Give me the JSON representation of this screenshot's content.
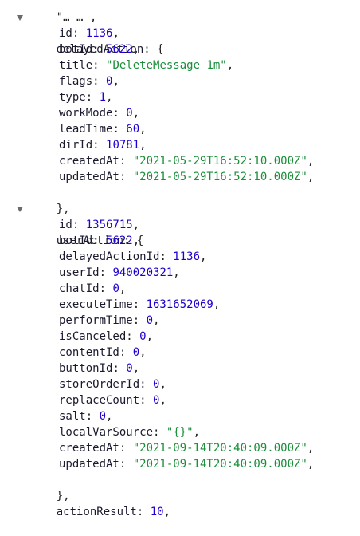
{
  "colors": {
    "key": "#1a1a2e",
    "number": "#1c00cf",
    "string": "#1a8f3a",
    "toggle": "#6b6b6b"
  },
  "top_cut": "\"… … ,",
  "delayedAction": {
    "key": "delayedAction",
    "open": ": {",
    "close": "},",
    "icon": "collapse-triangle-icon",
    "fields": [
      {
        "key": "id",
        "value": "1136",
        "kind": "num"
      },
      {
        "key": "botId",
        "value": "5622",
        "kind": "num"
      },
      {
        "key": "title",
        "value": "\"DeleteMessage 1m\"",
        "kind": "str"
      },
      {
        "key": "flags",
        "value": "0",
        "kind": "num"
      },
      {
        "key": "type",
        "value": "1",
        "kind": "num"
      },
      {
        "key": "workMode",
        "value": "0",
        "kind": "num"
      },
      {
        "key": "leadTime",
        "value": "60",
        "kind": "num"
      },
      {
        "key": "dirId",
        "value": "10781",
        "kind": "num"
      },
      {
        "key": "createdAt",
        "value": "\"2021-05-29T16:52:10.000Z\"",
        "kind": "str"
      },
      {
        "key": "updatedAt",
        "value": "\"2021-05-29T16:52:10.000Z\"",
        "kind": "str"
      }
    ]
  },
  "userAction": {
    "key": "userAction",
    "open": ": {",
    "close": "},",
    "icon": "collapse-triangle-icon",
    "fields": [
      {
        "key": "id",
        "value": "1356715",
        "kind": "num"
      },
      {
        "key": "botId",
        "value": "5622",
        "kind": "num"
      },
      {
        "key": "delayedActionId",
        "value": "1136",
        "kind": "num"
      },
      {
        "key": "userId",
        "value": "940020321",
        "kind": "num"
      },
      {
        "key": "chatId",
        "value": "0",
        "kind": "num"
      },
      {
        "key": "executeTime",
        "value": "1631652069",
        "kind": "num"
      },
      {
        "key": "performTime",
        "value": "0",
        "kind": "num"
      },
      {
        "key": "isCanceled",
        "value": "0",
        "kind": "num"
      },
      {
        "key": "contentId",
        "value": "0",
        "kind": "num"
      },
      {
        "key": "buttonId",
        "value": "0",
        "kind": "num"
      },
      {
        "key": "storeOrderId",
        "value": "0",
        "kind": "num"
      },
      {
        "key": "replaceCount",
        "value": "0",
        "kind": "num"
      },
      {
        "key": "salt",
        "value": "0",
        "kind": "num"
      },
      {
        "key": "localVarSource",
        "value": "\"{}\"",
        "kind": "str"
      },
      {
        "key": "createdAt",
        "value": "\"2021-09-14T20:40:09.000Z\"",
        "kind": "str"
      },
      {
        "key": "updatedAt",
        "value": "\"2021-09-14T20:40:09.000Z\"",
        "kind": "str"
      }
    ]
  },
  "actionResult": {
    "key": "actionResult",
    "value": "10",
    "kind": "num"
  },
  "punct": {
    "colon": ": ",
    "comma": ","
  }
}
